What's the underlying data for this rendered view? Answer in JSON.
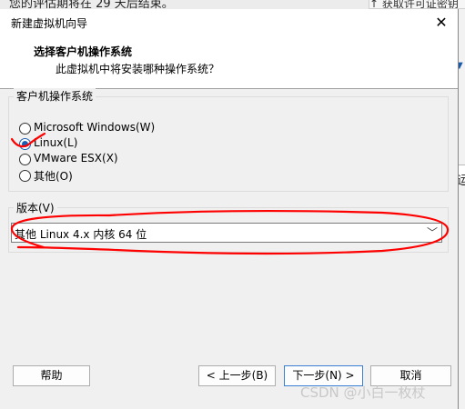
{
  "background": {
    "top_left_text": "您的评估期将在 29 天后结束。",
    "top_right_text": "↑ 获取许可证密钥",
    "right_icon": "vmware-logo-icon",
    "right_glyph": "运"
  },
  "dialog": {
    "title": "新建虚拟机向导",
    "close_symbol": "✕",
    "header_title": "选择客户机操作系统",
    "header_subtitle": "此虚拟机中将安装哪种操作系统？",
    "os_group": {
      "label": "客户机操作系统",
      "options": [
        {
          "label": "Microsoft Windows(W)",
          "selected": false
        },
        {
          "label": "Linux(L)",
          "selected": true
        },
        {
          "label": "VMware ESX(X)",
          "selected": false
        },
        {
          "label": "其他(O)",
          "selected": false
        }
      ]
    },
    "version_group": {
      "label": "版本(V)",
      "selected_value": "其他 Linux 4.x 内核 64 位",
      "arrow": "﹀"
    },
    "buttons": {
      "help": "帮助",
      "back": "< 上一步(B)",
      "next": "下一步(N) >",
      "cancel": "取消"
    }
  },
  "watermark": "CSDN @小白一枚杖",
  "annotation_color": "#ff0000"
}
